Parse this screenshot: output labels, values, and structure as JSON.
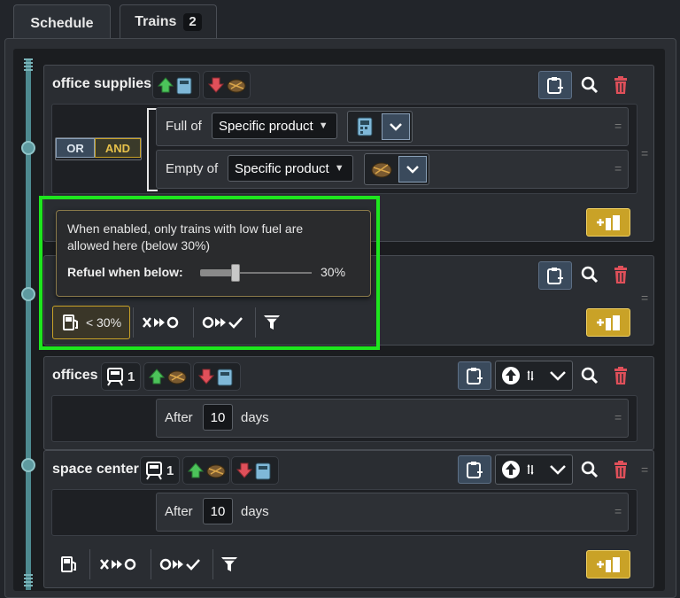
{
  "tabs": {
    "schedule": "Schedule",
    "trains": "Trains",
    "trains_count": "2"
  },
  "stations": [
    {
      "name": "office supplies"
    },
    {
      "name": "offices",
      "train_count": "1"
    },
    {
      "name": "space center",
      "train_count": "1"
    }
  ],
  "conditions": {
    "or_label": "OR",
    "and_label": "AND",
    "row1": {
      "label": "Full of",
      "dropdown": "Specific product"
    },
    "row2": {
      "label": "Empty of",
      "dropdown": "Specific product"
    }
  },
  "tooltip": {
    "text": "When enabled, only trains with low fuel are allowed here (below 30%)",
    "slider_label": "Refuel when below:",
    "slider_value": "30%",
    "slider_fraction": 0.3
  },
  "toolbar": {
    "fuel_label": "< 30%"
  },
  "wait": {
    "after_label": "After",
    "days_label": "days",
    "offices_days": "10",
    "space_days": "10"
  },
  "icons": [
    "clipboard-add-icon",
    "search-icon",
    "trash-icon",
    "fuel-icon",
    "filter-icon",
    "add-station-icon"
  ],
  "colors": {
    "accent_green": "#1ee61e",
    "gold": "#c9a227",
    "delete_red": "#e0505a"
  }
}
